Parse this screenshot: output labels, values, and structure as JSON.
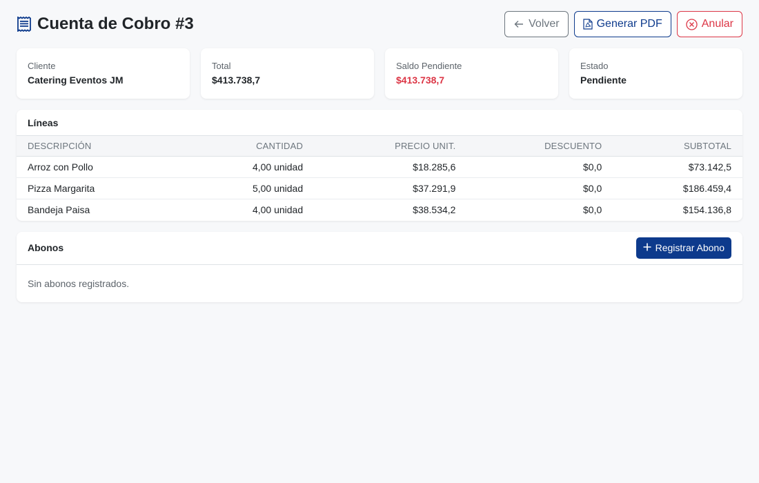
{
  "header": {
    "title": "Cuenta de Cobro #3",
    "buttons": {
      "back_label": "Volver",
      "pdf_label": "Generar PDF",
      "cancel_label": "Anular"
    }
  },
  "summary": {
    "cliente": {
      "label": "Cliente",
      "value": "Catering Eventos JM"
    },
    "total": {
      "label": "Total",
      "value": "$413.738,7"
    },
    "saldo": {
      "label": "Saldo Pendiente",
      "value": "$413.738,7"
    },
    "estado": {
      "label": "Estado",
      "value": "Pendiente"
    }
  },
  "lineas": {
    "title": "Líneas",
    "columns": [
      "DESCRIPCIÓN",
      "CANTIDAD",
      "PRECIO UNIT.",
      "DESCUENTO",
      "SUBTOTAL"
    ],
    "rows": [
      [
        "Arroz con Pollo",
        "4,00 unidad",
        "$18.285,6",
        "$0,0",
        "$73.142,5"
      ],
      [
        "Pizza Margarita",
        "5,00 unidad",
        "$37.291,9",
        "$0,0",
        "$186.459,4"
      ],
      [
        "Bandeja Paisa",
        "4,00 unidad",
        "$38.534,2",
        "$0,0",
        "$154.136,8"
      ]
    ]
  },
  "abonos": {
    "title": "Abonos",
    "add_label": "Registrar Abono",
    "empty_text": "Sin abonos registrados."
  },
  "colors": {
    "primary": "#0d3a8c",
    "danger": "#dc3545",
    "secondary": "#6c757d"
  },
  "icons": {
    "title": "receipt-icon",
    "back": "arrow-left-icon",
    "pdf": "file-pdf-icon",
    "cancel": "x-circle-icon",
    "add": "plus-icon"
  }
}
